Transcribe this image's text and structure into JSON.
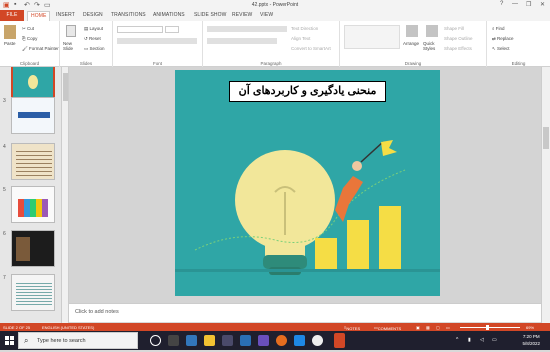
{
  "window": {
    "title": "42.pptx - PowerPoint",
    "qat": [
      "save-icon",
      "undo-icon",
      "redo-icon",
      "present-icon"
    ],
    "controls": [
      "?",
      "—",
      "❐",
      "✕"
    ]
  },
  "tabs": [
    "FILE",
    "HOME",
    "INSERT",
    "DESIGN",
    "TRANSITIONS",
    "ANIMATIONS",
    "SLIDE SHOW",
    "REVIEW",
    "VIEW"
  ],
  "active_tab": "HOME",
  "ribbon": {
    "clipboard": {
      "paste": "Paste",
      "cut": "Cut",
      "copy": "Copy",
      "painter": "Format Painter",
      "label": "Clipboard"
    },
    "slides": {
      "new_slide": "New Slide",
      "layout": "Layout",
      "reset": "Reset",
      "section": "Section",
      "label": "Slides"
    },
    "font": {
      "label": "Font"
    },
    "paragraph": {
      "text_direction": "Text Direction",
      "align_text": "Align Text",
      "smartart": "Convert to SmartArt",
      "label": "Paragraph"
    },
    "drawing": {
      "arrange": "Arrange",
      "quick_styles": "Quick Styles",
      "shape_fill": "Shape Fill",
      "shape_outline": "Shape Outline",
      "shape_effects": "Shape Effects",
      "label": "Drawing"
    },
    "editing": {
      "find": "Find",
      "replace": "Replace",
      "select": "Select",
      "label": "Editing"
    }
  },
  "thumbnails": [
    {
      "num": "3"
    },
    {
      "num": "4"
    },
    {
      "num": "5"
    },
    {
      "num": "6"
    },
    {
      "num": "7"
    }
  ],
  "slide": {
    "title": "منحنی یادگیری و کاربردهای آن",
    "bg_color": "#2fa6a6"
  },
  "notes_placeholder": "Click to add notes",
  "status": {
    "slide_of": "SLIDE 2 OF 25",
    "language": "ENGLISH (UNITED STATES)",
    "notes": "NOTES",
    "comments": "COMMENTS",
    "zoom": "69%"
  },
  "taskbar": {
    "search_placeholder": "Type here to search",
    "time": "7:20 PM",
    "date": "5/8/2022"
  }
}
